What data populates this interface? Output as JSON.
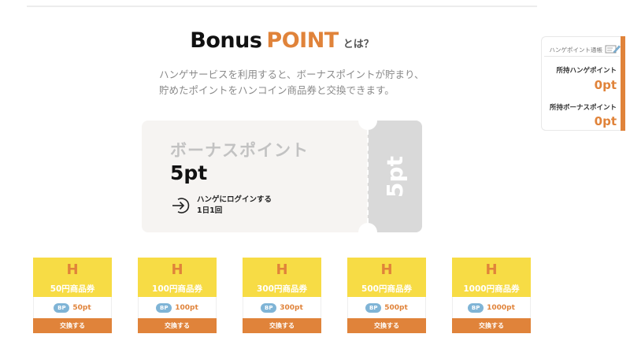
{
  "heading": {
    "word1": "Bonus",
    "word2": "POINT",
    "suffix": "とは？"
  },
  "description": {
    "line1": "ハンゲサービスを利用すると、ボーナスポイントが貯まり、",
    "line2": "貯めたポイントをハンコイン商品券と交換できます。"
  },
  "ticket": {
    "label": "ボーナスポイント",
    "amount": "5pt",
    "condition_line1": "ハンゲにログインする",
    "condition_line2": "1日1回",
    "stub_text": "5pt",
    "icon": "login-arrow-icon"
  },
  "side_panel": {
    "header": "ハンゲポイント通帳",
    "header_icon": "passbook-pen-icon",
    "hange_label": "所持ハンゲポイント",
    "hange_value": "0pt",
    "bonus_label": "所持ボーナスポイント",
    "bonus_value": "0pt"
  },
  "cards": [
    {
      "mark": "H",
      "name": "50円商品券",
      "badge": "BP",
      "points": "50pt",
      "button": "交換する"
    },
    {
      "mark": "H",
      "name": "100円商品券",
      "badge": "BP",
      "points": "100pt",
      "button": "交換する"
    },
    {
      "mark": "H",
      "name": "300円商品券",
      "badge": "BP",
      "points": "300pt",
      "button": "交換する"
    },
    {
      "mark": "H",
      "name": "500円商品券",
      "badge": "BP",
      "points": "500pt",
      "button": "交換する"
    },
    {
      "mark": "H",
      "name": "1000円商品券",
      "badge": "BP",
      "points": "1000pt",
      "button": "交換する"
    }
  ],
  "colors": {
    "accent": "#e0833a",
    "voucher_yellow": "#f7dc45",
    "badge_blue": "#7fb4d6",
    "ticket_bg": "#f6f4f2",
    "stub_gray": "#d9d9d9"
  }
}
